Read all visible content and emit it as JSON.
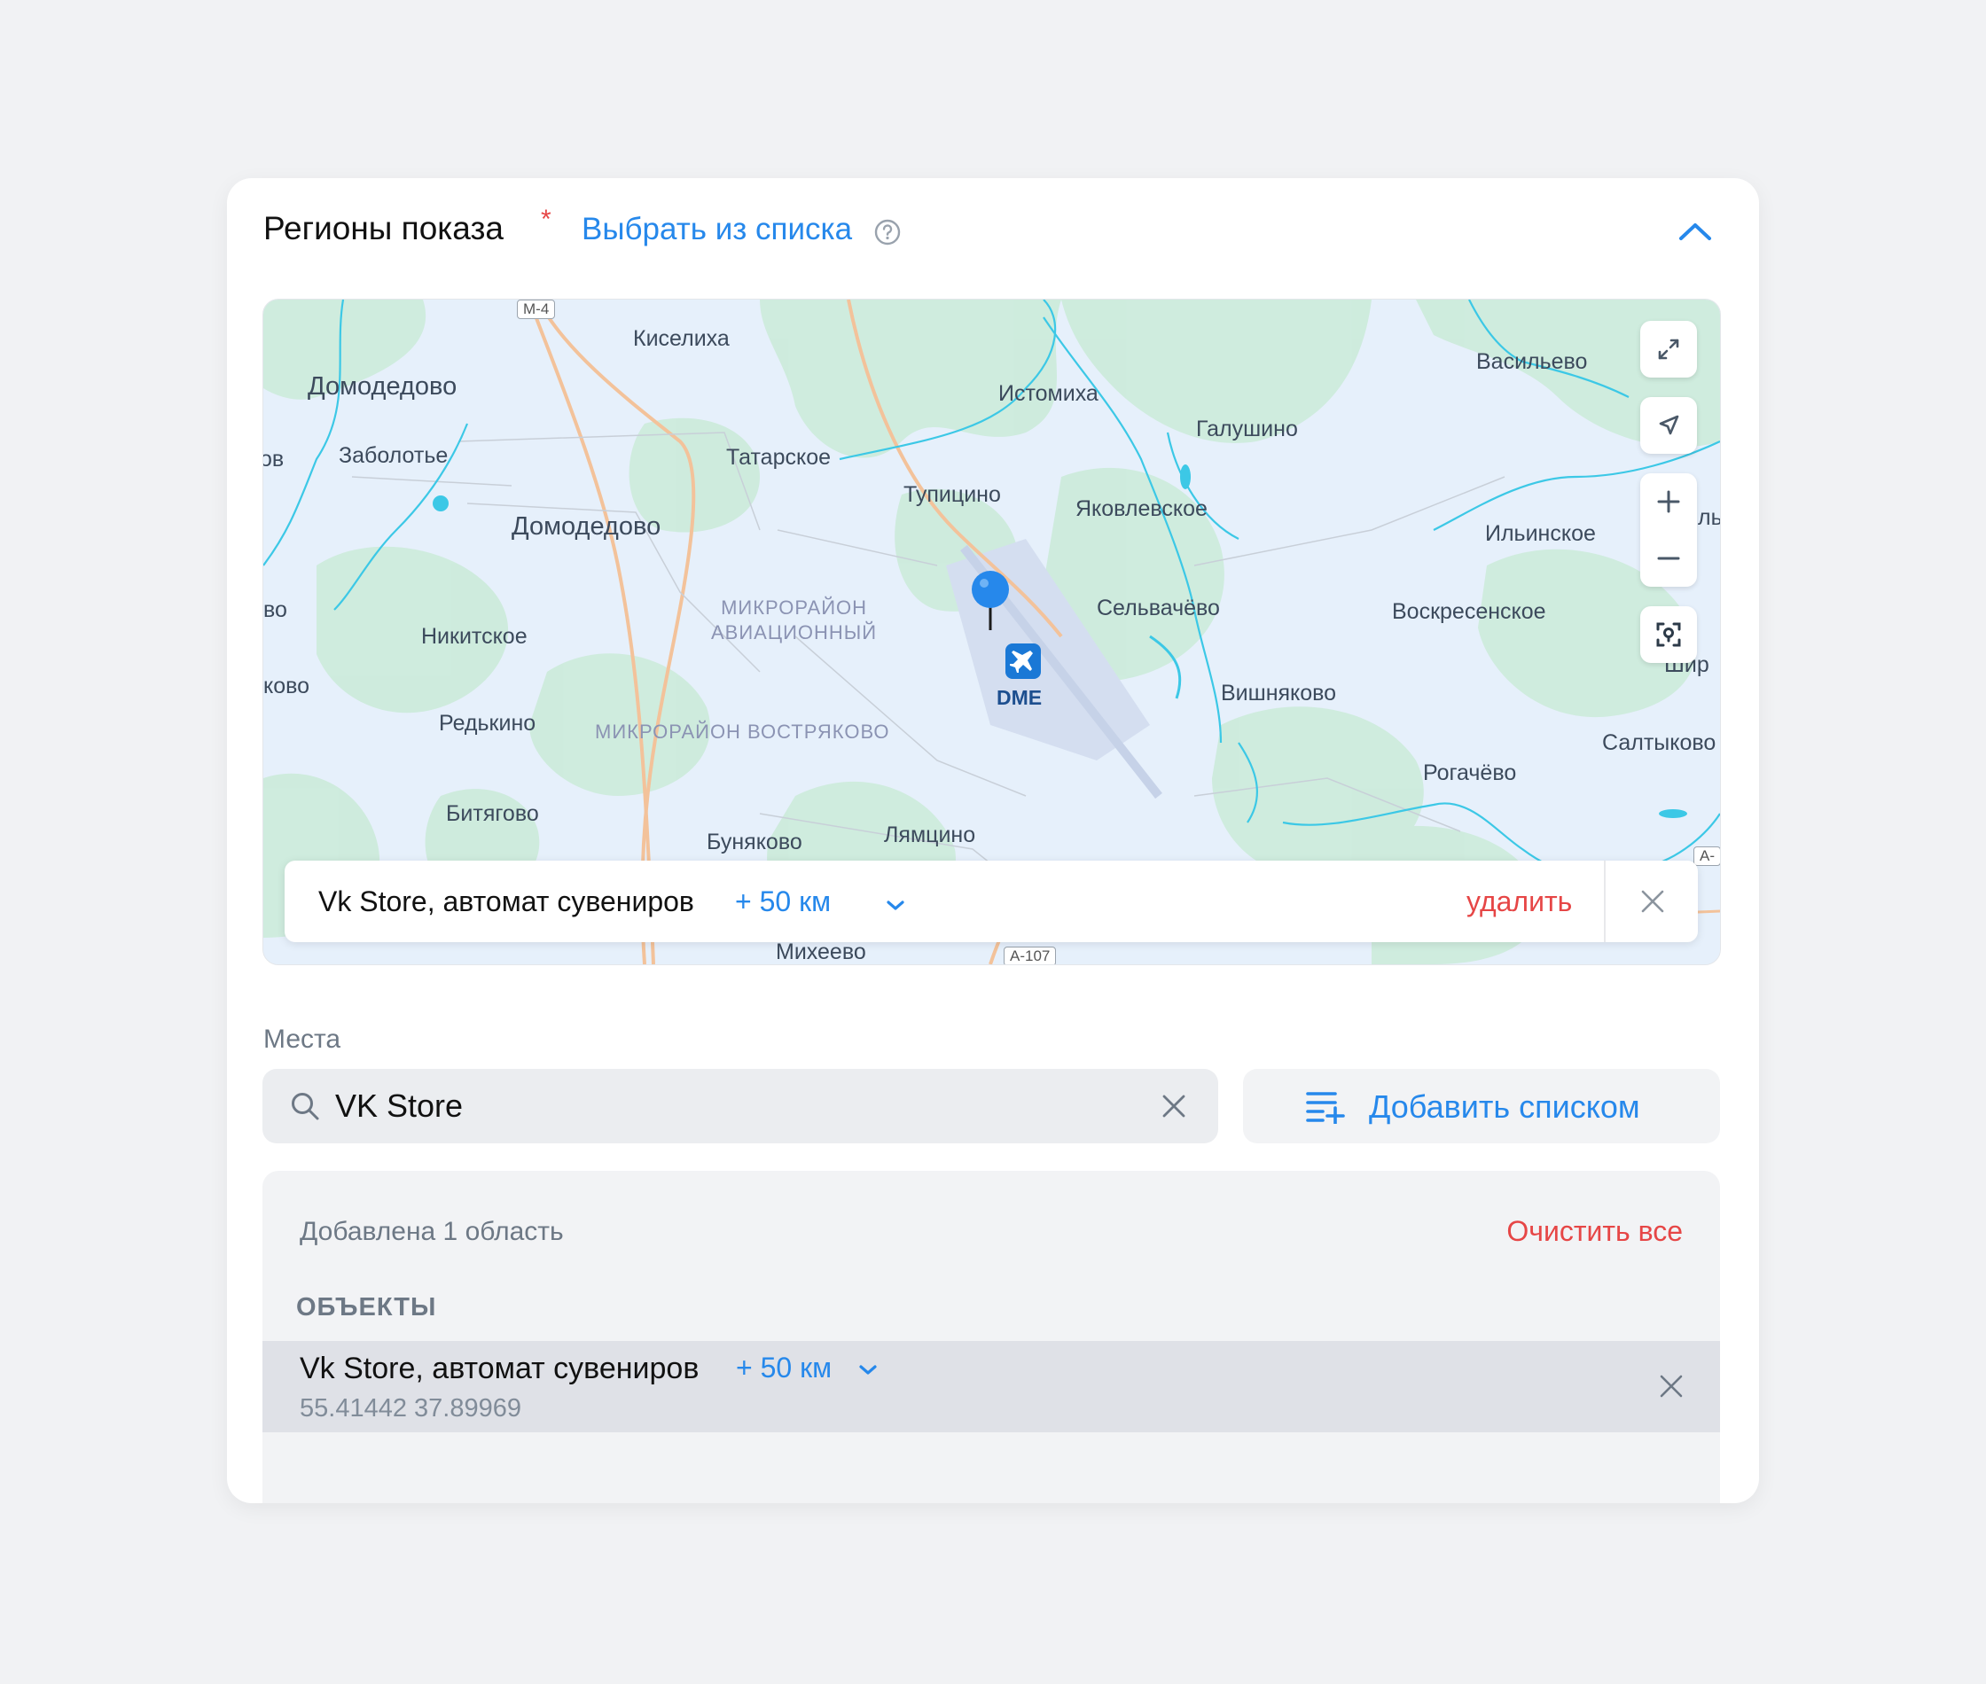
{
  "header": {
    "title": "Регионы показа",
    "required_mark": "*",
    "choose_link": "Выбрать из списка",
    "help_icon": "question-circle-icon",
    "collapse_icon": "chevron-up-icon"
  },
  "map": {
    "labels": {
      "domodedovo_1": "Домодедово",
      "domodedovo_2": "Домодедово",
      "kiselikha": "Киселиха",
      "istomikha": "Истомиха",
      "galushino": "Галушино",
      "vasilevo": "Васильево",
      "zabolote": "Заболотье",
      "tatarskoe": "Татарское",
      "tupitsino": "Тупицино",
      "yakovlevskoe": "Яковлевское",
      "ilinskoe": "Ильинское",
      "mkr_aviation": "МИКРОРАЙОН\nАВИАЦИОННЫЙ",
      "selvachevo": "Сельвачёво",
      "voskresenskoe": "Воскресенское",
      "nikitskoe": "Никитское",
      "vishnyakovo": "Вишняково",
      "redkino": "Редькино",
      "mkr_vostryakovo": "МИКРОРАЙОН ВОСТРЯКОВО",
      "saltykovo": "Салтыково",
      "rogachevo": "Рогачёво",
      "bityagovo": "Битягово",
      "bunyakovo": "Буняково",
      "lyamtsino": "Лямцино",
      "mikheevo": "Михеево",
      "edge_vo": "ов",
      "edge_bo": "во",
      "edge_kovo": "ково",
      "edge_shir": "Шир",
      "edge_il": "ль"
    },
    "roads": {
      "m4": "М-4",
      "a107": "А-107",
      "a_edge": "А-"
    },
    "airport_code": "DME",
    "controls": {
      "fullscreen": "expand-icon",
      "locate": "navigation-arrow-icon",
      "zoom_in": "plus-icon",
      "zoom_out": "minus-icon",
      "focus": "location-focus-icon"
    },
    "popup": {
      "place": "Vk Store, автомат сувениров",
      "radius": "+ 50 км",
      "delete": "удалить"
    }
  },
  "places": {
    "label": "Места",
    "search_value": "VK Store",
    "add_list": "Добавить списком"
  },
  "summary": {
    "count_text": "Добавлена 1 область",
    "clear_all": "Очистить все",
    "section": "ОБЪЕКТЫ",
    "items": [
      {
        "name": "Vk Store, автомат сувениров",
        "radius": "+ 50 км",
        "coords": "55.41442 37.89969"
      }
    ]
  },
  "colors": {
    "accent": "#2688eb",
    "danger": "#e64646",
    "secondary_text": "#6d7885",
    "map_water": "#3cc8e6",
    "map_forest": "#cdebdc",
    "map_road": "#f3c29a"
  }
}
